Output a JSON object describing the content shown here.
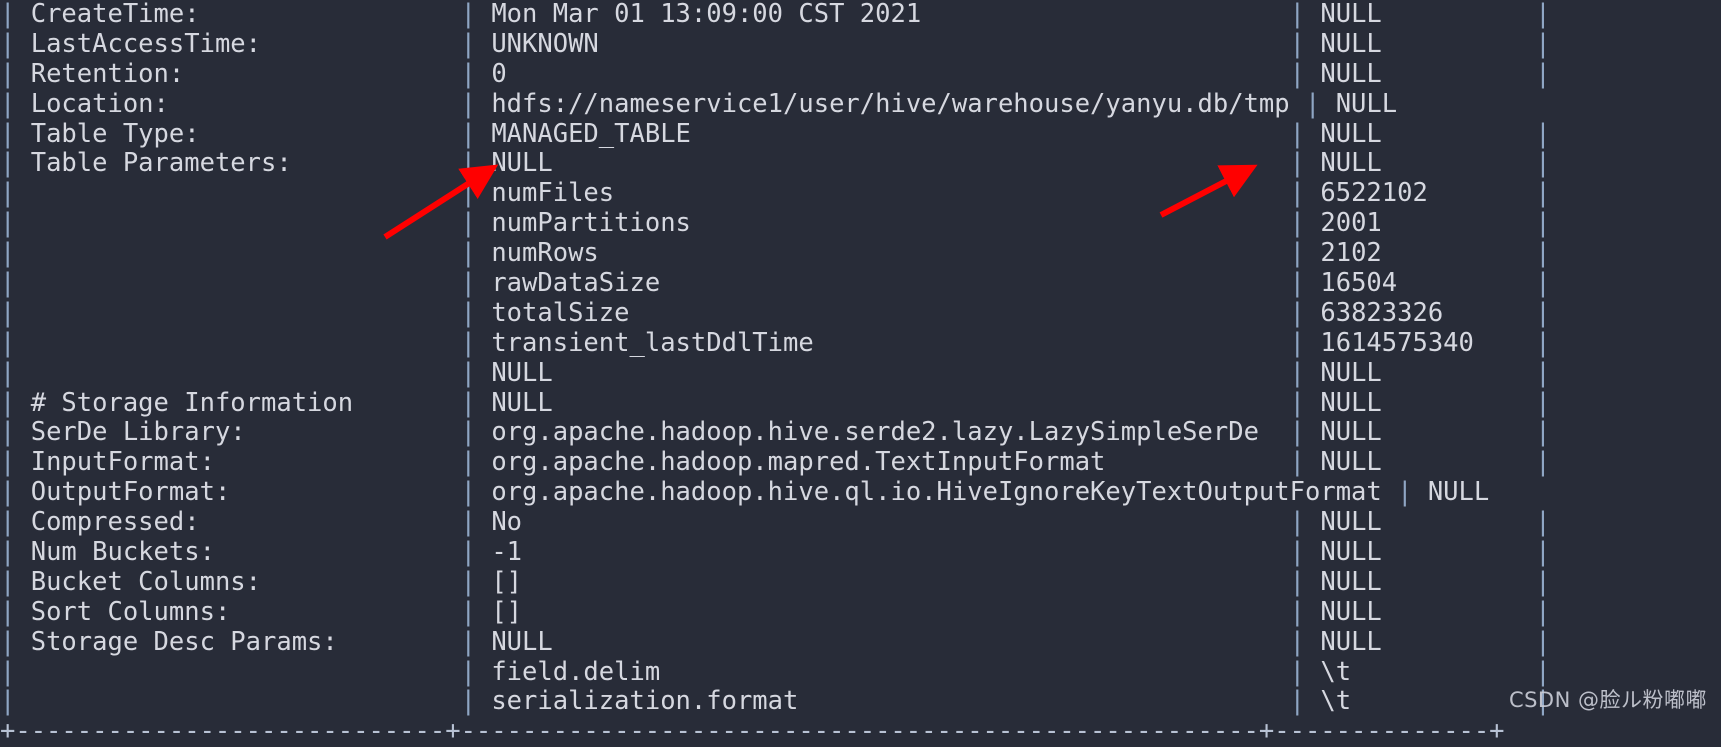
{
  "terminal": {
    "background_color": "#282c38",
    "text_color": "#d6d8e0",
    "separator_color": "#8fa6c4",
    "annotation_color": "#ff0000",
    "command_context": "Hive DESCRIBE FORMATTED output",
    "column_separator": "|",
    "rows": [
      {
        "col1": "CreateTime:",
        "col2": "Mon Mar 01 13:09:00 CST 2021",
        "col3": "NULL",
        "overflow": false
      },
      {
        "col1": "LastAccessTime:",
        "col2": "UNKNOWN",
        "col3": "NULL",
        "overflow": false
      },
      {
        "col1": "Retention:",
        "col2": "0",
        "col3": "NULL",
        "overflow": false
      },
      {
        "col1": "Location:",
        "col2": "hdfs://nameservice1/user/hive/warehouse/yanyu.db/tmp",
        "col3": "NULL",
        "overflow": true
      },
      {
        "col1": "Table Type:",
        "col2": "MANAGED_TABLE",
        "col3": "NULL",
        "overflow": false
      },
      {
        "col1": "Table Parameters:",
        "col2": "NULL",
        "col3": "NULL",
        "overflow": false
      },
      {
        "col1": "",
        "col2": "numFiles",
        "col3": "6522102",
        "overflow": false
      },
      {
        "col1": "",
        "col2": "numPartitions",
        "col3": "2001",
        "overflow": false
      },
      {
        "col1": "",
        "col2": "numRows",
        "col3": "2102",
        "overflow": false
      },
      {
        "col1": "",
        "col2": "rawDataSize",
        "col3": "16504",
        "overflow": false
      },
      {
        "col1": "",
        "col2": "totalSize",
        "col3": "63823326",
        "overflow": false
      },
      {
        "col1": "",
        "col2": "transient_lastDdlTime",
        "col3": "1614575340",
        "overflow": false
      },
      {
        "col1": "",
        "col2": "NULL",
        "col3": "NULL",
        "overflow": false
      },
      {
        "col1": "# Storage Information",
        "col2": "NULL",
        "col3": "NULL",
        "overflow": false
      },
      {
        "col1": "SerDe Library:",
        "col2": "org.apache.hadoop.hive.serde2.lazy.LazySimpleSerDe",
        "col3": "NULL",
        "overflow": false
      },
      {
        "col1": "InputFormat:",
        "col2": "org.apache.hadoop.mapred.TextInputFormat",
        "col3": "NULL",
        "overflow": false
      },
      {
        "col1": "OutputFormat:",
        "col2": "org.apache.hadoop.hive.ql.io.HiveIgnoreKeyTextOutputFormat",
        "col3": "NULL",
        "overflow": true
      },
      {
        "col1": "Compressed:",
        "col2": "No",
        "col3": "NULL",
        "overflow": false
      },
      {
        "col1": "Num Buckets:",
        "col2": "-1",
        "col3": "NULL",
        "overflow": false
      },
      {
        "col1": "Bucket Columns:",
        "col2": "[]",
        "col3": "NULL",
        "overflow": false
      },
      {
        "col1": "Sort Columns:",
        "col2": "[]",
        "col3": "NULL",
        "overflow": false
      },
      {
        "col1": "Storage Desc Params:",
        "col2": "NULL",
        "col3": "NULL",
        "overflow": false
      },
      {
        "col1": "",
        "col2": "field.delim",
        "col3": "\\t",
        "overflow": false
      },
      {
        "col1": "",
        "col2": "serialization.format",
        "col3": "\\t",
        "overflow": false
      }
    ],
    "bottom_border": "+----------------------------+----------------------------------------------------+--------------+"
  },
  "annotations": [
    {
      "name": "arrow-to-numfiles",
      "target_label": "numFiles",
      "color": "#ff0000"
    },
    {
      "name": "arrow-to-numfiles-value",
      "target_label": "6522102",
      "color": "#ff0000"
    }
  ],
  "watermark": {
    "text": "CSDN @脸ル粉嘟嘟"
  }
}
